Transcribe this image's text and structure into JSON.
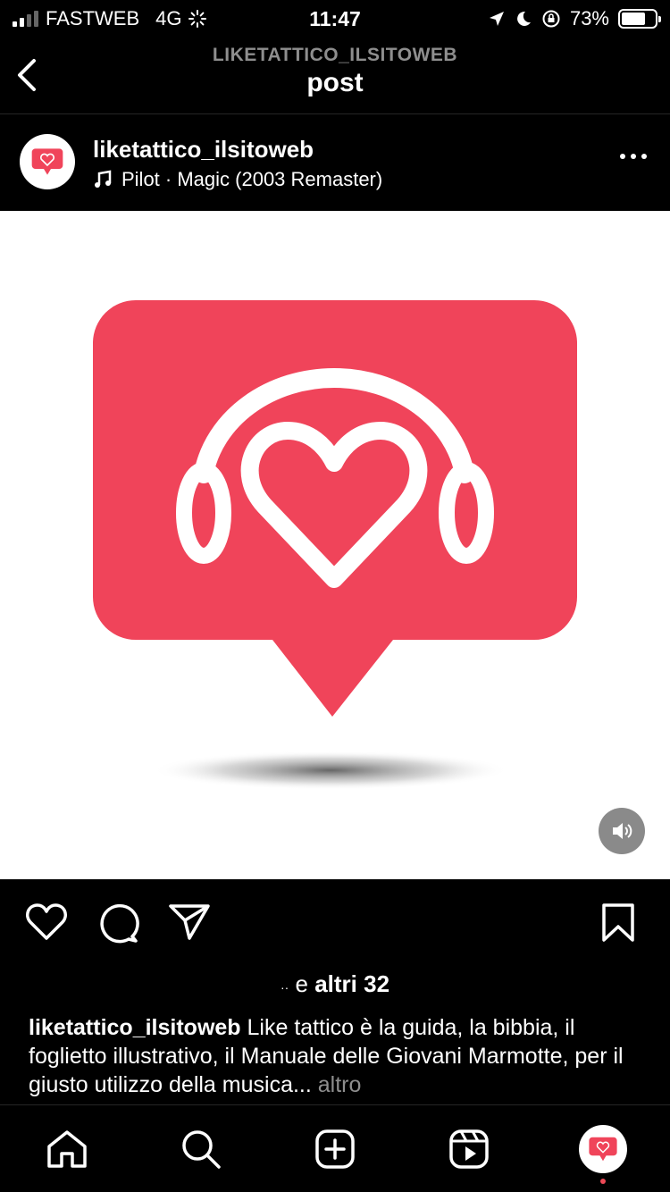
{
  "status_bar": {
    "carrier": "FASTWEB",
    "network": "4G",
    "time": "11:47",
    "battery": "73%",
    "battery_level": 0.73
  },
  "nav": {
    "subtitle": "LIKETATTICO_ILSITOWEB",
    "title": "post"
  },
  "post": {
    "username": "liketattico_ilsitoweb",
    "music": "Pilot · Magic (2003 Remaster)"
  },
  "likes": {
    "prefix": "e",
    "others": "altri 32"
  },
  "caption": {
    "user": "liketattico_ilsitoweb",
    "text": "Like tattico è la guida, la bibbia, il foglietto illustrativo, il Manuale delle Giovani Marmotte, per il giusto utilizzo della musica...",
    "more": "altro"
  },
  "colors": {
    "brand": "#f0445a",
    "background": "#000000",
    "secondary_text": "#8e8e8e"
  }
}
